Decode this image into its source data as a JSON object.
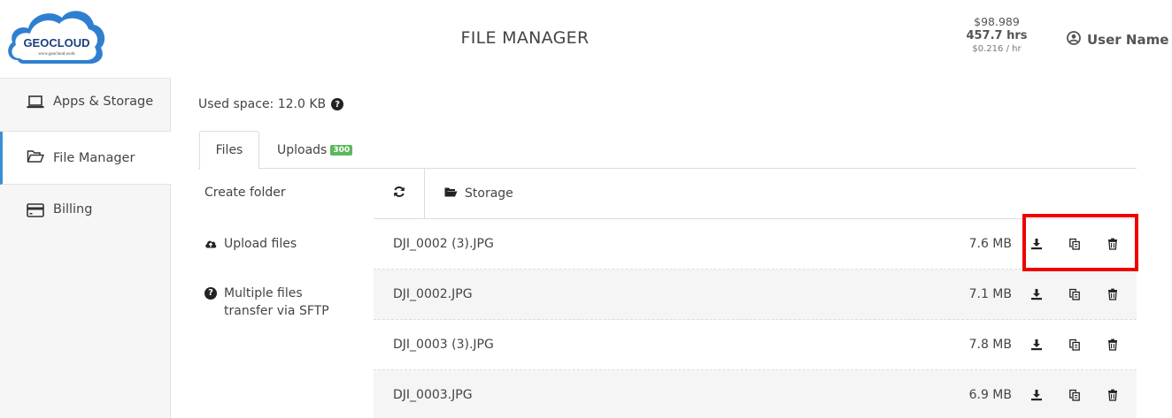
{
  "header": {
    "logo_text": "GEOCLOUD",
    "logo_url_text": "www.geocloud.work",
    "title": "FILE MANAGER",
    "balance": "$98.989",
    "hours": "457.7 hrs",
    "rate": "$0.216 / hr",
    "user_name": "User Name"
  },
  "sidebar": {
    "items": [
      {
        "label": "Apps & Storage",
        "icon": "laptop-icon"
      },
      {
        "label": "File Manager",
        "icon": "folder-open-icon"
      },
      {
        "label": "Billing",
        "icon": "credit-card-icon"
      }
    ]
  },
  "main": {
    "used_space": "Used space: 12.0 KB",
    "tabs": {
      "files": "Files",
      "uploads": "Uploads",
      "uploads_count": "300"
    },
    "actions": {
      "create_folder": "Create folder",
      "upload_files": "Upload files",
      "sftp_line1": "Multiple files",
      "sftp_line2": "transfer via SFTP"
    },
    "breadcrumb": "Storage",
    "files": [
      {
        "name": "DJI_0002 (3).JPG",
        "size": "7.6 MB"
      },
      {
        "name": "DJI_0002.JPG",
        "size": "7.1 MB"
      },
      {
        "name": "DJI_0003 (3).JPG",
        "size": "7.8 MB"
      },
      {
        "name": "DJI_0003.JPG",
        "size": "6.9 MB"
      }
    ]
  },
  "colors": {
    "accent_border": "#3a8fd8",
    "badge_green": "#5cb85c",
    "highlight_red": "#ee0000",
    "logo_blue": "#1b5fa8"
  }
}
